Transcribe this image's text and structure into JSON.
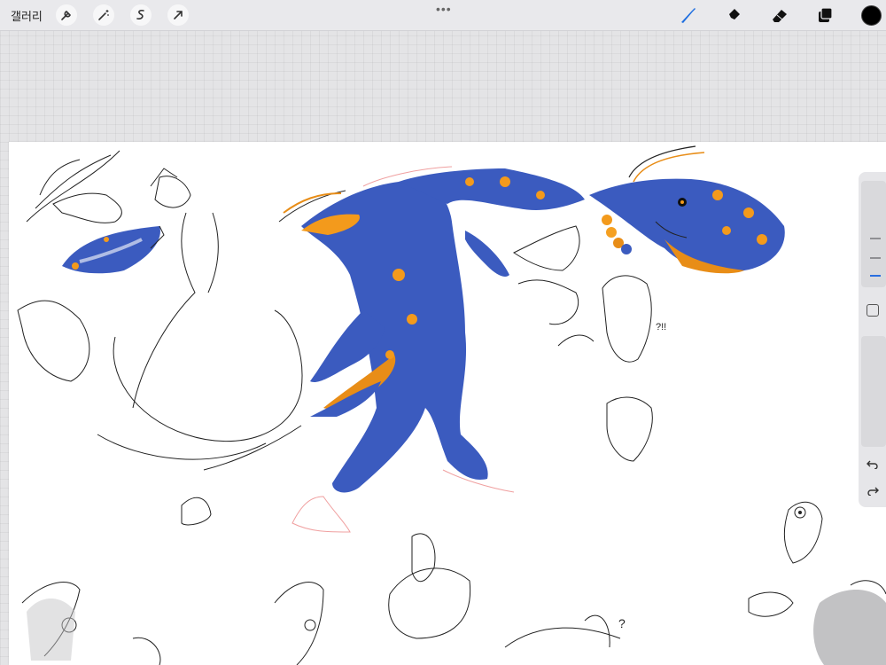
{
  "toolbar": {
    "gallery_label": "갤러리",
    "left_tools": [
      "wrench-icon",
      "magic-wand-icon",
      "selection-icon",
      "transform-arrow-icon"
    ],
    "more_label": "•••",
    "right_tools": [
      "brush-icon",
      "smudge-icon",
      "eraser-icon",
      "layers-icon"
    ],
    "active_tool": "brush-icon",
    "current_color": "#000000"
  },
  "sidebar": {
    "brush_size": 0.8,
    "tools": [
      "modify-button",
      "undo-icon",
      "redo-icon"
    ]
  },
  "canvas": {
    "annotations": [
      "?!!",
      "?"
    ],
    "palette": [
      "#f39a1c",
      "#f5a021",
      "#e88d17",
      "#3b5bbf"
    ]
  }
}
